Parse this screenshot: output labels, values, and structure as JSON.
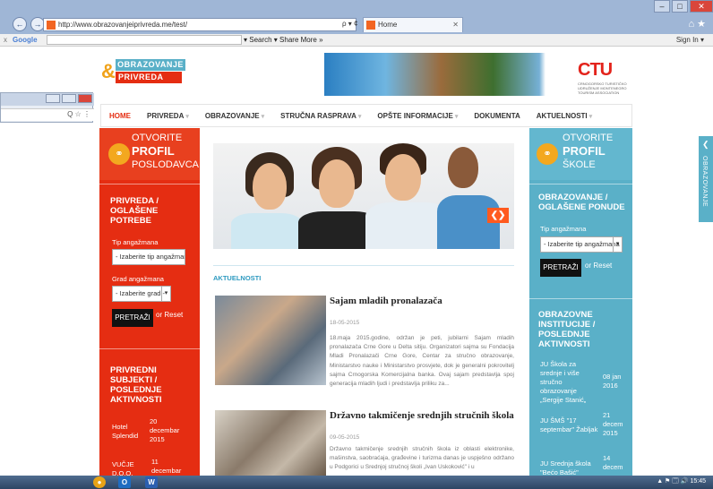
{
  "browser": {
    "win_controls": [
      "–",
      "□",
      "✕"
    ],
    "back": "←",
    "forward": "→",
    "url": "http://www.obrazovanjeiprivreda.me/test/",
    "addr_tools": "ρ ▾ ¢",
    "tab_title": "Home",
    "tab_close": "✕",
    "home_star": "⌂ ★",
    "g_x": "x",
    "google": "Google",
    "g_tools": "▾ Search ▾   Share   More »",
    "signin": "Sign In ▾",
    "frag_field": "Q ☆ ⋮"
  },
  "logo": {
    "amp": "&",
    "top": "OBRAZOVANJE",
    "bottom": "PRIVREDA"
  },
  "banner": {
    "ctu": "CTU",
    "ctu_sub": "CRNOGORSKO TURISTIČKO UDRUŽENJE MONTENEGRO TOURISM ASSOCIATION"
  },
  "menu": [
    {
      "label": "HOME",
      "caret": ""
    },
    {
      "label": "PRIVREDA",
      "caret": "▾"
    },
    {
      "label": "OBRAZOVANJE",
      "caret": "▾"
    },
    {
      "label": "STRUČNA RASPRAVA",
      "caret": "▾"
    },
    {
      "label": "OPŠTE INFORMACIJE",
      "caret": "▾"
    },
    {
      "label": "DOKUMENTA",
      "caret": ""
    },
    {
      "label": "AKTUELNOSTI",
      "caret": "▾"
    }
  ],
  "left": {
    "head1": "OTVORITE",
    "head2": "PROFIL",
    "head3": "POSLODAVCA",
    "sec1": "PRIVREDA / OGLAŠENE POTREBE",
    "lbl_tip": "Tip angažmana",
    "sel_tip": "- Izaberite tip angažmana",
    "lbl_grad": "Grad angažmana",
    "sel_grad": "- Izaberite grad -",
    "search": "PRETRAŽI",
    "reset": "or Reset",
    "sec2": "PRIVREDNI SUBJEKTI / POSLEDNJE AKTIVNOSTI",
    "acts": [
      {
        "name": "Hotel Splendid",
        "date": "20 decembar 2015"
      },
      {
        "name": "VUČJE D.O.O.",
        "date": "11 decembar"
      }
    ]
  },
  "right": {
    "head1": "OTVORITE",
    "head2": "PROFIL",
    "head3": "ŠKOLE",
    "sec1": "OBRAZOVANJE / OGLAŠENE PONUDE",
    "lbl_tip": "Tip angažmana",
    "sel_tip": "- Izaberite tip angažmana -",
    "search": "PRETRAŽI",
    "reset": "or Reset",
    "sec2": "OBRAZOVNE INSTITUCIJE / POSLEDNJE AKTIVNOSTI",
    "acts": [
      {
        "name": "JU Škola za srednje i više stručno obrazovanje „Sergije Stanić„",
        "date": "08 jan 2016"
      },
      {
        "name": "JU ŠMŠ \"17 septembar\" Žabljak",
        "date": "21 decem 2015"
      },
      {
        "name": "JU Srednja škola \"Bećo Bašić\"",
        "date": "14 decem"
      }
    ]
  },
  "side_tab": {
    "arrow": "❮",
    "label": "OBRAZOVANJE"
  },
  "hero": {
    "arrows": "❮❯"
  },
  "news": {
    "heading": "AKTUELNOSTI",
    "items": [
      {
        "title": "Sajam mladih pronalazača",
        "date": "18-05-2015",
        "text": "18.maja 2015.godine, održan je peti, jubilarni Sajam mladih pronalazača Crne Gore u Delta sitiju. Organizatori sajma su Fondacija Mladi Pronalazači Crne Gore, Centar za stručno obrazovanje, Ministarstvo nauke i Ministarstvo prosvjete, dok je generalni pokrovitelj sajma Crnogorska Komercijalna banka. Ovaj sajam predstavlja spoj generacija mladih ljudi i predstavlja priliku za..."
      },
      {
        "title": "Državno takmičenje srednjih stručnih škola",
        "date": "09-05-2015",
        "text": "Državno takmičenje srednjih stručnih škola iz oblasti elektronike, mašinstva, saobraćaja, građevine i turizma danas je uspješno održano u Podgorici u Srednjoj stručnoj školi „Ivan Uskoković\" i u"
      }
    ]
  },
  "taskbar": {
    "tray": "▲ ⚑ 🗔 🔊  15:45"
  }
}
